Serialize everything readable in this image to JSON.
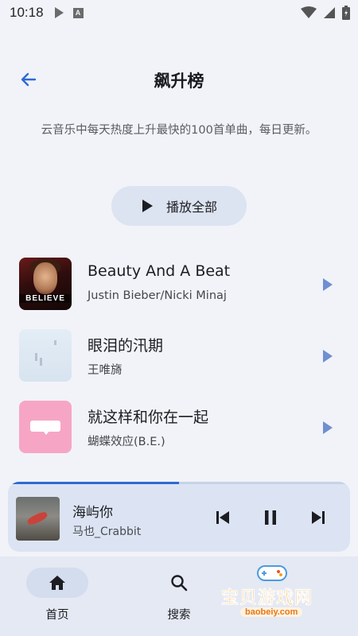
{
  "status_bar": {
    "time": "10:18",
    "badge_letter": "A"
  },
  "header": {
    "title": "飙升榜"
  },
  "description": "云音乐中每天热度上升最快的100首单曲，每日更新。",
  "play_all": {
    "label": "播放全部",
    "icon": "play-icon"
  },
  "songs": [
    {
      "title": "Beauty And A Beat",
      "artist": "Justin Bieber/Nicki Minaj",
      "cover_text": "BELIEVE"
    },
    {
      "title": "眼泪的汛期",
      "artist": "王唯旖"
    },
    {
      "title": "就这样和你在一起",
      "artist": "蝴蝶效应(B.E.)"
    }
  ],
  "now_playing": {
    "title": "海屿你",
    "artist": "马也_Crabbit",
    "progress": 0.5,
    "controls": [
      "skip-previous-icon",
      "pause-icon",
      "skip-next-icon"
    ]
  },
  "nav": {
    "items": [
      {
        "label": "首页",
        "icon": "home-icon",
        "active": true
      },
      {
        "label": "搜索",
        "icon": "search-icon",
        "active": false
      }
    ]
  },
  "watermark": {
    "text": "宝贝游戏网",
    "url": "baobeiy.com"
  },
  "colors": {
    "accent": "#2f6bd1",
    "row_play": "#6f8fcf",
    "background": "#f1f3f9",
    "player_bg": "#dce4f3",
    "nav_bg": "#e4e9f3"
  }
}
